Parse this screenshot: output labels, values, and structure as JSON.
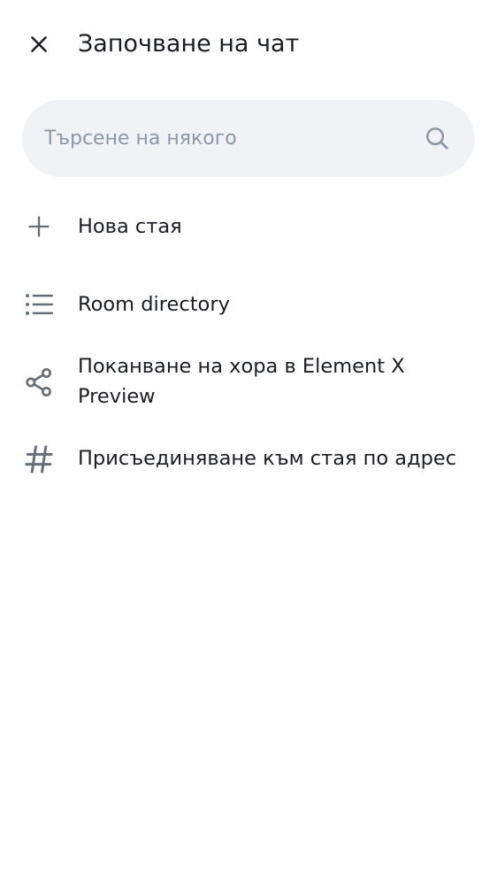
{
  "header": {
    "title": "Започване на чат",
    "close_icon": "close-icon"
  },
  "search": {
    "placeholder": "Търсене на някого",
    "value": "",
    "icon": "search-icon"
  },
  "menu": {
    "items": [
      {
        "label": "Нова стая",
        "icon": "plus-icon"
      },
      {
        "label": "Room directory",
        "icon": "list-icon"
      },
      {
        "label": "Поканване на хора в Element X Preview",
        "icon": "share-icon"
      },
      {
        "label": "Присъединяване към стая по адрес",
        "icon": "hash-icon"
      }
    ]
  },
  "colors": {
    "icon": "#656d77",
    "text": "#1b1d22",
    "placeholder": "#8d97a5",
    "search_bg": "#f0f2f5",
    "background": "#ffffff"
  }
}
